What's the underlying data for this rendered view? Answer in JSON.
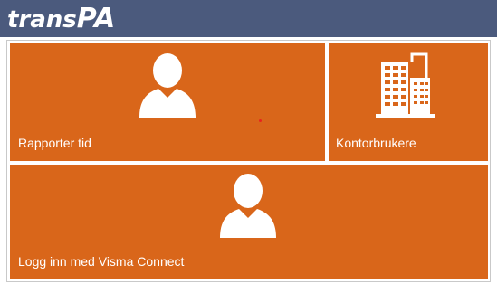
{
  "app": {
    "logo_part1": "trans",
    "logo_part2": "PA"
  },
  "tiles": [
    {
      "label": "Rapporter tid",
      "icon": "person-icon"
    },
    {
      "label": "Kontorbrukere",
      "icon": "building-icon"
    },
    {
      "label": "Logg inn med Visma Connect",
      "icon": "person-icon"
    }
  ],
  "colors": {
    "header": "#4b5a7d",
    "tile": "#d9661a",
    "text": "#ffffff"
  }
}
